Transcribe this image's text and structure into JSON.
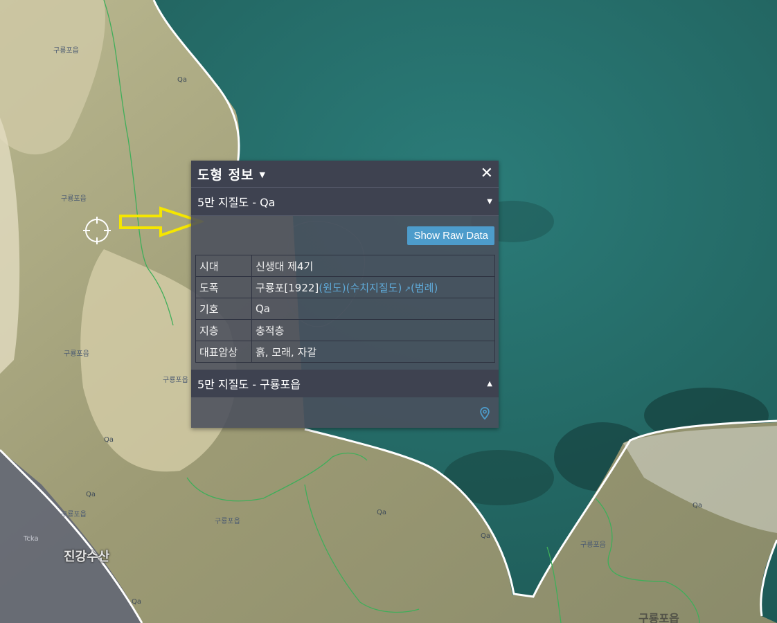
{
  "map": {
    "labels": [
      {
        "text": "구룡포읍"
      },
      {
        "text": "Qa"
      },
      {
        "text": "구룡포읍"
      },
      {
        "text": "구룡포읍"
      },
      {
        "text": "구룡포읍"
      },
      {
        "text": "구룡포읍"
      },
      {
        "text": "Qa"
      },
      {
        "text": "구룡포읍"
      },
      {
        "text": "Qa"
      },
      {
        "text": "Qa"
      },
      {
        "text": "Qa"
      },
      {
        "text": "구룡포읍"
      },
      {
        "text": "Qa"
      },
      {
        "text": "Tcka"
      },
      {
        "text": "Qa"
      },
      {
        "text": "진강수산"
      },
      {
        "text": "구룡포읍"
      }
    ],
    "colors": {
      "sea": "#2a7370",
      "boundary": "#ffffff",
      "contact_line": "#3fae5a",
      "arrow": "#f5e600"
    },
    "icons": {
      "locator": "crosshair-icon",
      "pointer": "arrow-right-icon"
    }
  },
  "panel": {
    "title": "도형 정보",
    "close_icon": "close-icon",
    "section1": {
      "label": "5만 지질도 - Qa",
      "raw_button": "Show Raw Data",
      "rows": [
        {
          "key": "시대",
          "value": "신생대 제4기"
        },
        {
          "key": "도폭",
          "value": "구룡포[1922]",
          "links": [
            "(원도)",
            "(수치지질도)",
            "(범례)"
          ]
        },
        {
          "key": "기호",
          "value": "Qa"
        },
        {
          "key": "지층",
          "value": "충적층"
        },
        {
          "key": "대표암상",
          "value": "흙, 모래, 자갈"
        }
      ]
    },
    "section2": {
      "label": "5만 지질도 - 구룡포읍",
      "pin_icon": "map-pin-icon"
    }
  }
}
